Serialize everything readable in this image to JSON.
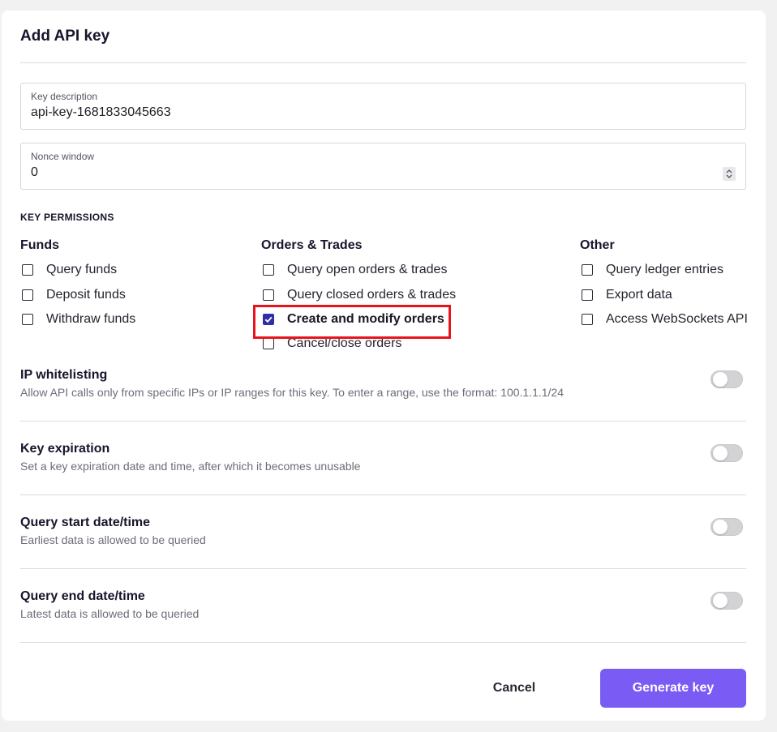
{
  "dialog": {
    "title": "Add API key"
  },
  "fields": {
    "description": {
      "label": "Key description",
      "value": "api-key-1681833045663"
    },
    "nonce": {
      "label": "Nonce window",
      "value": "0"
    }
  },
  "permissions": {
    "heading": "KEY PERMISSIONS",
    "funds": {
      "title": "Funds",
      "items": [
        {
          "label": "Query funds",
          "checked": false
        },
        {
          "label": "Deposit funds",
          "checked": false
        },
        {
          "label": "Withdraw funds",
          "checked": false
        }
      ]
    },
    "orders": {
      "title": "Orders & Trades",
      "items": [
        {
          "label": "Query open orders & trades",
          "checked": false
        },
        {
          "label": "Query closed orders & trades",
          "checked": false
        },
        {
          "label": "Create and modify orders",
          "checked": true
        },
        {
          "label": "Cancel/close orders",
          "checked": false
        }
      ]
    },
    "other": {
      "title": "Other",
      "items": [
        {
          "label": "Query ledger entries",
          "checked": false
        },
        {
          "label": "Export data",
          "checked": false
        },
        {
          "label": "Access WebSockets API",
          "checked": false
        }
      ]
    }
  },
  "options": [
    {
      "title": "IP whitelisting",
      "description": "Allow API calls only from specific IPs or IP ranges for this key. To enter a range, use the format: 100.1.1.1/24",
      "enabled": false
    },
    {
      "title": "Key expiration",
      "description": "Set a key expiration date and time, after which it becomes unusable",
      "enabled": false
    },
    {
      "title": "Query start date/time",
      "description": "Earliest data is allowed to be queried",
      "enabled": false
    },
    {
      "title": "Query end date/time",
      "description": "Latest data is allowed to be queried",
      "enabled": false
    }
  ],
  "actions": {
    "cancel_label": "Cancel",
    "generate_label": "Generate key"
  },
  "colors": {
    "accent": "#7a5cf5",
    "checkbox_checked": "#2f2fa8",
    "highlight": "#e8141c"
  },
  "icons": {
    "checkmark": "check-icon",
    "spinner": "spinner-arrows-icon"
  }
}
